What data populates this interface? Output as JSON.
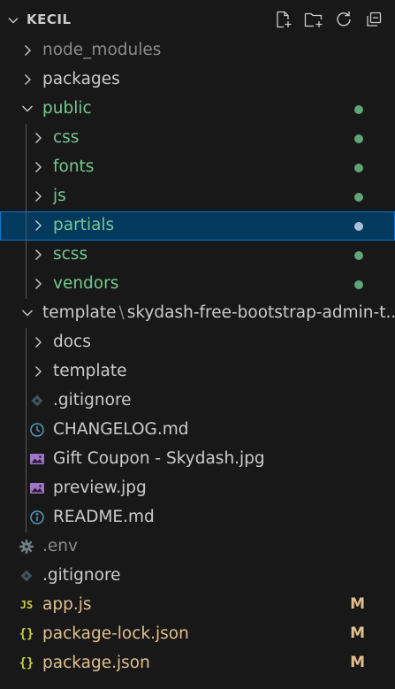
{
  "header": {
    "title": "KECIL",
    "actions": [
      {
        "name": "new-file-icon"
      },
      {
        "name": "new-folder-icon"
      },
      {
        "name": "refresh-icon"
      },
      {
        "name": "collapse-all-icon"
      }
    ]
  },
  "colors": {
    "background": "#181818",
    "text": "#cccccc",
    "untracked_green": "#73c991",
    "modified_yellow": "#e2c08d",
    "ignored_gray": "#8c8c8c",
    "selection_bg": "#04395e",
    "selection_border": "#0078d4"
  },
  "tree": [
    {
      "label": "node_modules",
      "type": "folder",
      "state": "collapsed",
      "depth": 0,
      "color": "gray"
    },
    {
      "label": "packages",
      "type": "folder",
      "state": "collapsed",
      "depth": 0,
      "color": "default"
    },
    {
      "label": "public",
      "type": "folder",
      "state": "expanded",
      "depth": 0,
      "color": "green",
      "decoration": "dot"
    },
    {
      "label": "css",
      "type": "folder",
      "state": "collapsed",
      "depth": 1,
      "color": "green",
      "decoration": "dot"
    },
    {
      "label": "fonts",
      "type": "folder",
      "state": "collapsed",
      "depth": 1,
      "color": "green",
      "decoration": "dot"
    },
    {
      "label": "js",
      "type": "folder",
      "state": "collapsed",
      "depth": 1,
      "color": "green",
      "decoration": "dot"
    },
    {
      "label": "partials",
      "type": "folder",
      "state": "collapsed",
      "depth": 1,
      "color": "green",
      "decoration": "dot",
      "selected": true
    },
    {
      "label": "scss",
      "type": "folder",
      "state": "collapsed",
      "depth": 1,
      "color": "green",
      "decoration": "dot"
    },
    {
      "label": "vendors",
      "type": "folder",
      "state": "collapsed",
      "depth": 1,
      "color": "green",
      "decoration": "dot"
    },
    {
      "label": "template",
      "label_suffix": "skydash-free-bootstrap-admin-t...",
      "type": "folder",
      "state": "expanded",
      "depth": 0,
      "color": "default"
    },
    {
      "label": "docs",
      "type": "folder",
      "state": "collapsed",
      "depth": 1,
      "color": "default"
    },
    {
      "label": "template",
      "type": "folder",
      "state": "collapsed",
      "depth": 1,
      "color": "default"
    },
    {
      "label": ".gitignore",
      "type": "file",
      "icon": "git-icon",
      "depth": 1,
      "color": "default"
    },
    {
      "label": "CHANGELOG.md",
      "type": "file",
      "icon": "clock-icon",
      "depth": 1,
      "color": "default"
    },
    {
      "label": "Gift Coupon - Skydash.jpg",
      "type": "file",
      "icon": "image-icon",
      "depth": 1,
      "color": "default"
    },
    {
      "label": "preview.jpg",
      "type": "file",
      "icon": "image-icon",
      "depth": 1,
      "color": "default"
    },
    {
      "label": "README.md",
      "type": "file",
      "icon": "info-icon",
      "depth": 1,
      "color": "default"
    },
    {
      "label": ".env",
      "type": "file",
      "icon": "gear-icon",
      "depth": 0,
      "color": "gray"
    },
    {
      "label": ".gitignore",
      "type": "file",
      "icon": "git-icon",
      "depth": 0,
      "color": "default"
    },
    {
      "label": "app.js",
      "type": "file",
      "icon": "js-icon",
      "icon_text": "JS",
      "depth": 0,
      "color": "yellow",
      "decoration": "M"
    },
    {
      "label": "package-lock.json",
      "type": "file",
      "icon": "json-icon",
      "icon_text": "{}",
      "depth": 0,
      "color": "yellow",
      "decoration": "M"
    },
    {
      "label": "package.json",
      "type": "file",
      "icon": "json-icon",
      "icon_text": "{}",
      "depth": 0,
      "color": "yellow",
      "decoration": "M"
    }
  ]
}
